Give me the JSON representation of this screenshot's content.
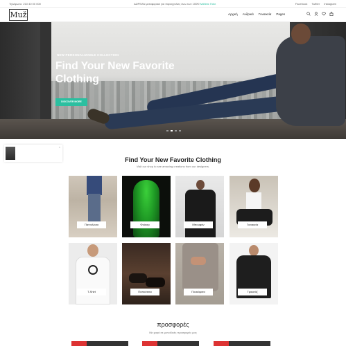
{
  "topbar": {
    "phone": "Τηλέφωνο: 210 40 00 000",
    "promo_text": "ΔΩΡΕΑΝ μεταφορικά για παραγγελίες άνω των 100€!",
    "promo_link": "Μάθετε Πότε",
    "social": [
      "Facebook",
      "Twitter",
      "Instagram"
    ]
  },
  "nav": {
    "logo": "Muž",
    "menu": [
      "Αρχική",
      "Ανδρικά",
      "Γυναικεία",
      "Pages"
    ],
    "icons": [
      "search-icon",
      "user-icon",
      "heart-icon",
      "bag-icon"
    ]
  },
  "hero": {
    "eyebrow": "NEW PERSONALIZABLE COLLECTION",
    "headline": "Find Your New Favorite Clothing",
    "cta": "DISCOVER MORE",
    "slides": 4,
    "active_slide": 2,
    "accent": "#2bbfa0"
  },
  "section": {
    "title": "Find Your New Favorite Clothing",
    "subtitle": "Visit our shop to see amazing creations from our designers."
  },
  "categories": [
    {
      "label": "Παντελόνια"
    },
    {
      "label": "Φούτερ"
    },
    {
      "label": "Μπουφάν"
    },
    {
      "label": "Γυναικεία"
    },
    {
      "label": "T-Shirt"
    },
    {
      "label": "Παπούτσια"
    },
    {
      "label": "Πουκάμισα"
    },
    {
      "label": "Τρικοτάζ"
    }
  ],
  "offers": {
    "title": "προσφορές",
    "subtitle": "Με χαρά σε μοναδικές προσφορές μας"
  }
}
